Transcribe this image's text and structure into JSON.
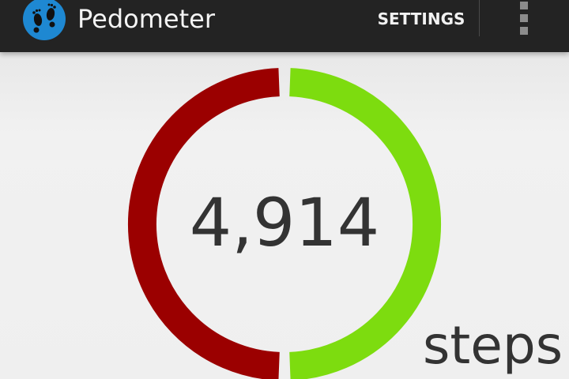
{
  "app": {
    "title": "Pedometer",
    "icon": "footprints-icon"
  },
  "action_bar": {
    "settings_label": "SETTINGS",
    "overflow_icon": "overflow-menu-icon"
  },
  "progress": {
    "steps": 4914,
    "steps_display": "4,914",
    "unit_label": "steps",
    "completed_fraction": 0.5,
    "completed_color": "#7ddc0f",
    "remaining_color": "#9b0000"
  },
  "colors": {
    "action_bar": "#232323",
    "icon_circle": "#1e88d2",
    "background": "#eeeeee",
    "text": "#333333"
  }
}
